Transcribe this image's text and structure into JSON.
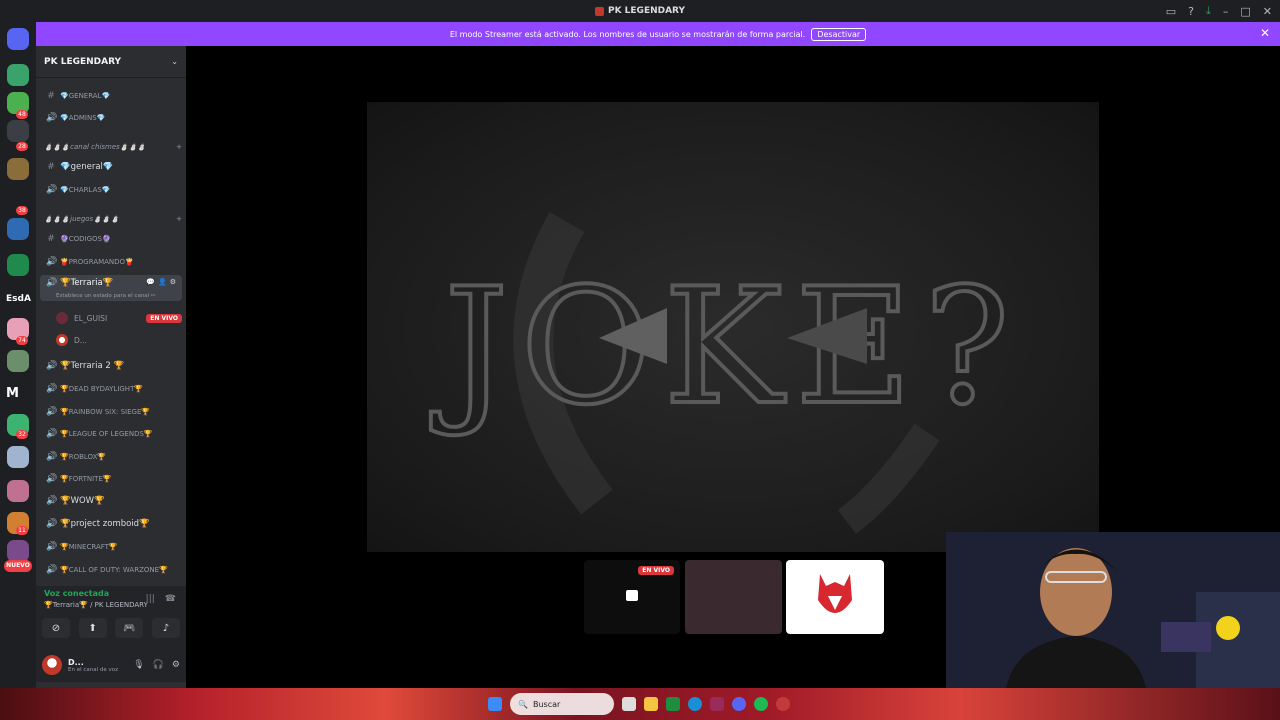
{
  "window": {
    "title": "PK LEGENDARY"
  },
  "banner": {
    "text": "El modo Streamer está activado. Los nombres de usuario se mostrarán de forma parcial.",
    "button": "Desactivar"
  },
  "rail": {
    "badges": [
      "48",
      "28",
      "38",
      "74",
      "32",
      "11"
    ],
    "text_server": "EsdA",
    "m_server": "M",
    "nuevo": "NUEVO"
  },
  "sidebar": {
    "server_name": "PK LEGENDARY",
    "channels_top": [
      {
        "label": "💎GENERAL💎",
        "type": "text"
      },
      {
        "label": "💎ADMINS💎",
        "type": "voice"
      }
    ],
    "category_1": "⛄⛄⛄canal chismes⛄⛄⛄",
    "channels_mid": [
      {
        "label": "💎general💎",
        "type": "text"
      },
      {
        "label": "💎CHARLAS💎",
        "type": "voice"
      }
    ],
    "category_2": "⛄⛄⛄juegos⛄⛄⛄",
    "channels_games": [
      {
        "label": "🔮CODIGOS🔮",
        "type": "text"
      },
      {
        "label": "🍟PROGRAMANDO🍟",
        "type": "voice"
      }
    ],
    "active_channel": "🏆Terraria🏆",
    "active_status": "Establece un estado para el canal ✏",
    "users": [
      {
        "name": "EL_GUISI",
        "live": "EN VIVO"
      },
      {
        "name": "D..."
      }
    ],
    "channels_rest": [
      "🏆Terraria 2 🏆",
      "🏆DEAD BYDAYLIGHT🏆",
      "🏆RAINBOW SIX: SIEGE🏆",
      "🏆LEAGUE OF LEGENDS🏆",
      "🏆ROBLOX🏆",
      "🏆FORTNITE🏆",
      "🏆WOW🏆",
      "🏆project zomboid🏆",
      "🏆MINECRAFT🏆",
      "🏆CALL OF DUTY: WARZONE🏆"
    ]
  },
  "voice": {
    "connected": "Voz conectada",
    "location": "🏆Terraria🏆 / PK LEGENDARY"
  },
  "userbar": {
    "name": "D...",
    "sub": "En el canal de voz"
  },
  "stream": {
    "artwork_text": "JOKE?",
    "tile_live": "EN VIVO"
  },
  "taskbar": {
    "search_placeholder": "Buscar"
  },
  "colors": {
    "accent": "#9146ff",
    "live": "#da373c",
    "connected": "#23a55a"
  }
}
